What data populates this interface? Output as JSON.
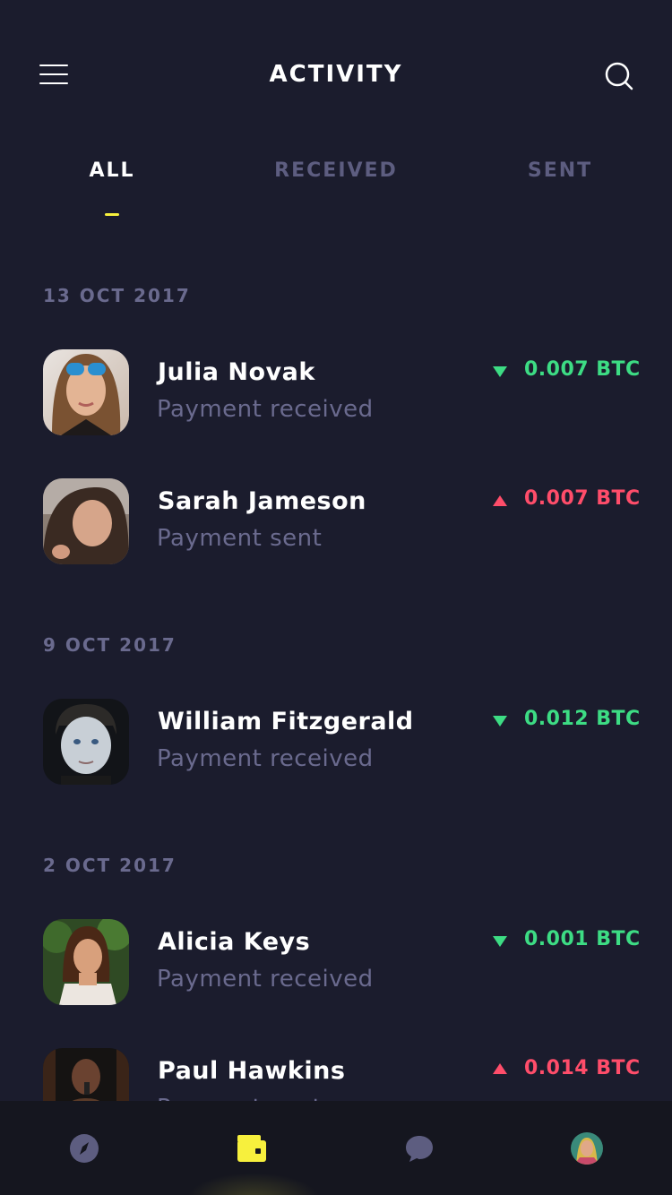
{
  "header": {
    "title": "ACTIVITY",
    "menu_icon": "hamburger-menu-icon",
    "search_icon": "search-icon"
  },
  "tabs": [
    {
      "label": "ALL",
      "active": true
    },
    {
      "label": "RECEIVED",
      "active": false
    },
    {
      "label": "SENT",
      "active": false
    }
  ],
  "accent_color": "#f7f03d",
  "received_color": "#3ddc84",
  "sent_color": "#ff4d6a",
  "groups": [
    {
      "date": "13 OCT 2017",
      "items": [
        {
          "name": "Julia Novak",
          "status": "Payment received",
          "amount": "0.007 BTC",
          "direction": "received"
        },
        {
          "name": "Sarah Jameson",
          "status": "Payment sent",
          "amount": "0.007 BTC",
          "direction": "sent"
        }
      ]
    },
    {
      "date": "9 OCT 2017",
      "items": [
        {
          "name": "William Fitzgerald",
          "status": "Payment received",
          "amount": "0.012 BTC",
          "direction": "received"
        }
      ]
    },
    {
      "date": "2 OCT 2017",
      "items": [
        {
          "name": "Alicia Keys",
          "status": "Payment received",
          "amount": "0.001 BTC",
          "direction": "received"
        },
        {
          "name": "Paul Hawkins",
          "status": "Payment sent",
          "amount": "0.014 BTC",
          "direction": "sent"
        }
      ]
    }
  ],
  "bottom_nav": [
    {
      "icon": "compass-icon",
      "active": false
    },
    {
      "icon": "wallet-icon",
      "active": true
    },
    {
      "icon": "chat-bubble-icon",
      "active": false
    },
    {
      "icon": "profile-avatar-icon",
      "active": false
    }
  ]
}
